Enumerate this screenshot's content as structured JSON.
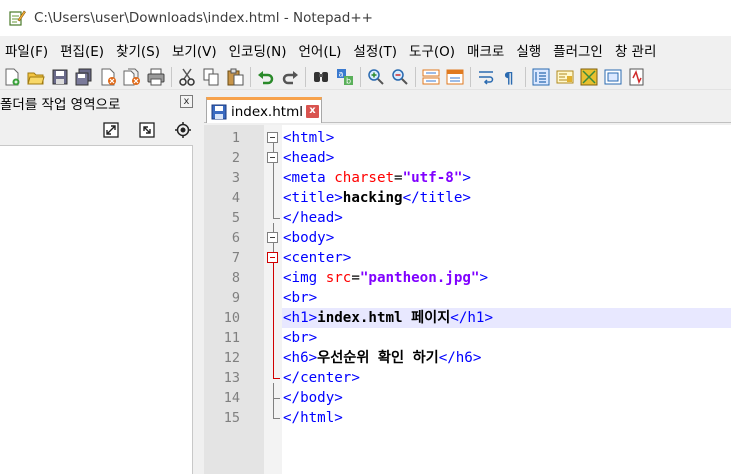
{
  "window": {
    "title": "C:\\Users\\user\\Downloads\\index.html - Notepad++"
  },
  "menu": {
    "items": [
      "파일(F)",
      "편집(E)",
      "찾기(S)",
      "보기(V)",
      "인코딩(N)",
      "언어(L)",
      "설정(T)",
      "도구(O)",
      "매크로",
      "실행",
      "플러그인",
      "창 관리"
    ]
  },
  "toolbar": {
    "icons": [
      "new-file-icon",
      "open-file-icon",
      "save-icon",
      "save-all-icon",
      "close-icon",
      "close-all-icon",
      "print-icon",
      "cut-icon",
      "copy-icon",
      "paste-icon",
      "undo-icon",
      "redo-icon",
      "find-icon",
      "replace-icon",
      "zoom-in-icon",
      "zoom-out-icon",
      "sync-vertical-icon",
      "sync-horizontal-icon",
      "word-wrap-icon",
      "show-all-chars-icon",
      "indent-guide-icon",
      "doc-map-icon",
      "function-list-icon",
      "folder-workspace-icon",
      "monitoring-icon"
    ]
  },
  "sidepanel": {
    "title": "폴더를 작업 영역으로",
    "close_label": "x"
  },
  "tab": {
    "label": "index.html",
    "close_label": "x"
  },
  "editor": {
    "current_line": 10,
    "lines": [
      {
        "n": "1",
        "tokens": [
          {
            "t": "tag",
            "v": "<html>"
          }
        ]
      },
      {
        "n": "2",
        "tokens": [
          {
            "t": "tag",
            "v": "<head>"
          }
        ]
      },
      {
        "n": "3",
        "tokens": [
          {
            "t": "tag",
            "v": "<meta "
          },
          {
            "t": "attr",
            "v": "charset"
          },
          {
            "t": "eq",
            "v": "="
          },
          {
            "t": "str",
            "v": "\"utf-8\""
          },
          {
            "t": "tag",
            "v": ">"
          }
        ]
      },
      {
        "n": "4",
        "tokens": [
          {
            "t": "tag",
            "v": "<title>"
          },
          {
            "t": "txt",
            "v": "hacking"
          },
          {
            "t": "tag",
            "v": "</title>"
          }
        ]
      },
      {
        "n": "5",
        "tokens": [
          {
            "t": "tag",
            "v": "</head>"
          }
        ]
      },
      {
        "n": "6",
        "tokens": [
          {
            "t": "tag",
            "v": "<body>"
          }
        ]
      },
      {
        "n": "7",
        "tokens": [
          {
            "t": "tag",
            "v": "<center>"
          }
        ]
      },
      {
        "n": "8",
        "tokens": [
          {
            "t": "tag",
            "v": "<img "
          },
          {
            "t": "attr",
            "v": "src"
          },
          {
            "t": "eq",
            "v": "="
          },
          {
            "t": "str",
            "v": "\"pantheon.jpg\""
          },
          {
            "t": "tag",
            "v": ">"
          }
        ]
      },
      {
        "n": "9",
        "tokens": [
          {
            "t": "tag",
            "v": "<br>"
          }
        ]
      },
      {
        "n": "10",
        "tokens": [
          {
            "t": "tag",
            "v": "<h1>"
          },
          {
            "t": "txt",
            "v": "index.html 페이지"
          },
          {
            "t": "tag",
            "v": "</h1>"
          }
        ]
      },
      {
        "n": "11",
        "tokens": [
          {
            "t": "tag",
            "v": "<br>"
          }
        ]
      },
      {
        "n": "12",
        "tokens": [
          {
            "t": "tag",
            "v": "<h6>"
          },
          {
            "t": "txt",
            "v": "우선순위 확인 하기"
          },
          {
            "t": "tag",
            "v": "</h6>"
          }
        ]
      },
      {
        "n": "13",
        "tokens": [
          {
            "t": "tag",
            "v": "</center>"
          }
        ]
      },
      {
        "n": "14",
        "tokens": [
          {
            "t": "tag",
            "v": "</body>"
          }
        ]
      },
      {
        "n": "15",
        "tokens": [
          {
            "t": "tag",
            "v": "</html>"
          }
        ]
      }
    ]
  },
  "colors": {
    "tag": "#0000ff",
    "attr": "#ff0000",
    "string": "#8000ff",
    "current_line": "#e8e8ff",
    "tab_accent": "#f7a24c"
  }
}
